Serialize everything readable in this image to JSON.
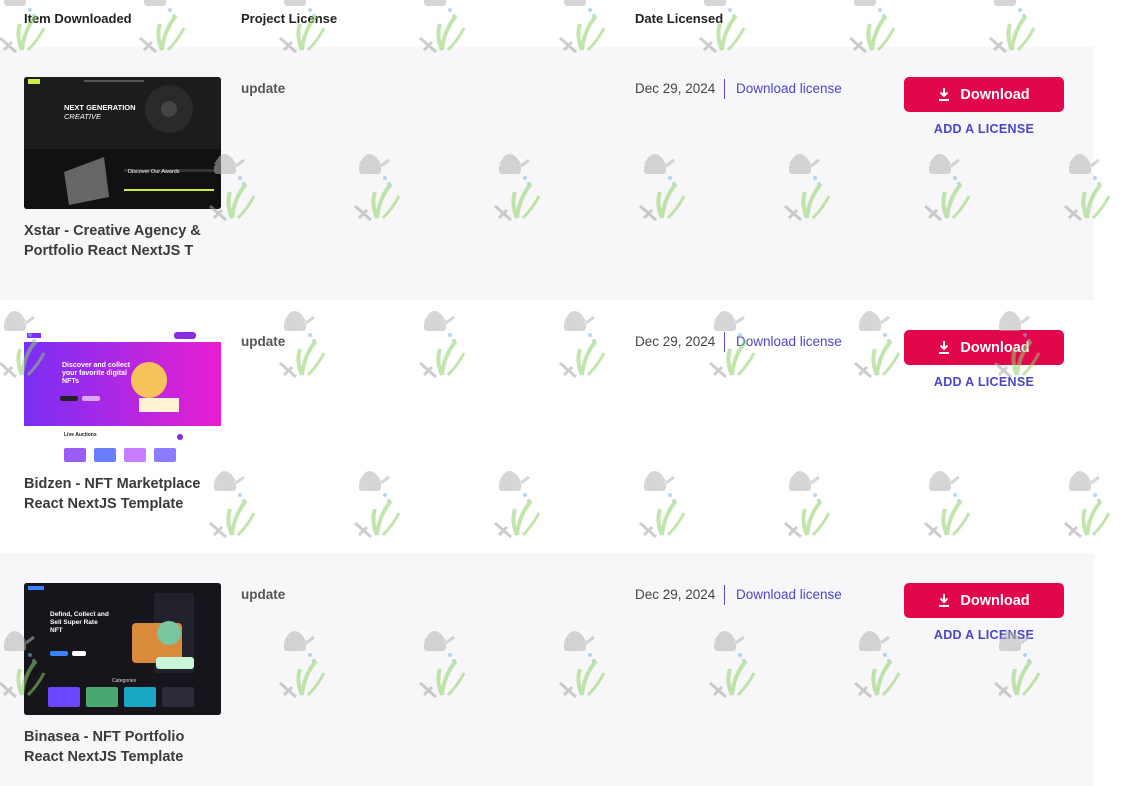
{
  "table": {
    "headers": {
      "item": "Item Downloaded",
      "license": "Project License",
      "date": "Date Licensed"
    },
    "rows": [
      {
        "title": "Xstar - Creative Agency & Portfolio React NextJS T",
        "license": "update",
        "date": "Dec 29, 2024",
        "download_link": "Download license",
        "download_button": "Download",
        "add_license": "ADD A LICENSE",
        "thumb": {
          "headline": "NEXT GENERATION",
          "subline": "CREATIVE",
          "sub2": "Discover Our Awards"
        }
      },
      {
        "title": "Bidzen - NFT Marketplace React NextJS Template",
        "license": "update",
        "date": "Dec 29, 2024",
        "download_link": "Download license",
        "download_button": "Download",
        "add_license": "ADD A LICENSE",
        "thumb": {
          "headline": "Discover and collect your favorite digital NFTs",
          "sub2": "Live Auctions"
        }
      },
      {
        "title": "Binasea - NFT Portfolio React NextJS Template",
        "license": "update",
        "date": "Dec 29, 2024",
        "download_link": "Download license",
        "download_button": "Download",
        "add_license": "ADD A LICENSE",
        "thumb": {
          "headline": "Defind, Collect and Sell Super Rate NFT",
          "sub2": "Categories"
        }
      }
    ]
  },
  "colors": {
    "accent_red": "#e2064a",
    "link_blue": "#4b46c8",
    "row_alt": "#f7f7f9"
  },
  "icons": {
    "download_button_icon": "download-icon",
    "watermark": "watering-can-plant-icon"
  }
}
